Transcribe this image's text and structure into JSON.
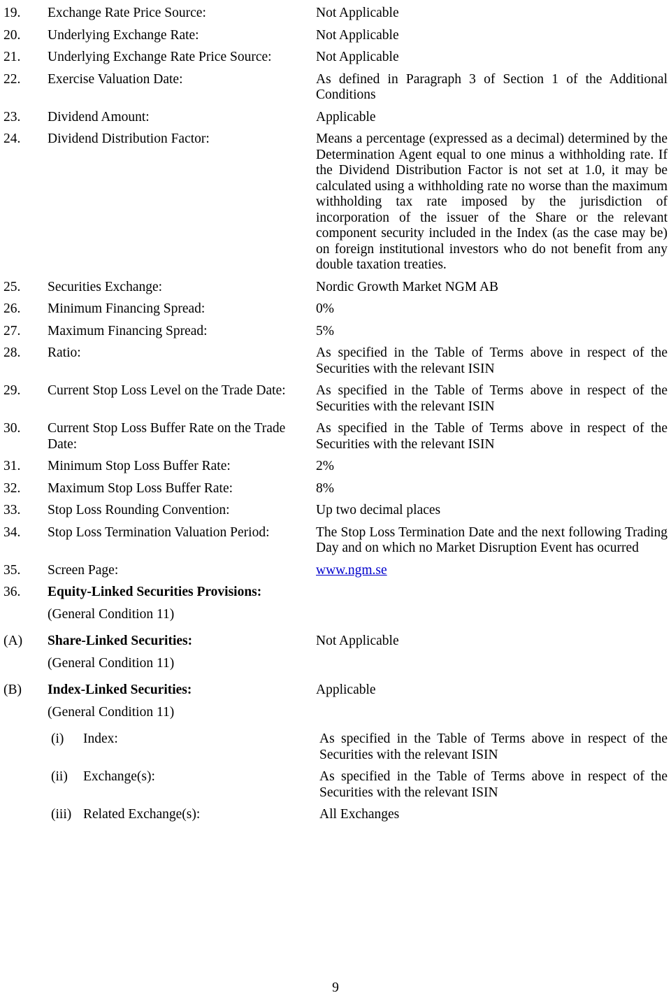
{
  "document": {
    "page_number": "9",
    "link_color": "#0000cc"
  },
  "items": [
    {
      "num": "19.",
      "label": "Exchange Rate Price Source:",
      "value": "Not Applicable"
    },
    {
      "num": "20.",
      "label": "Underlying Exchange Rate:",
      "value": "Not Applicable"
    },
    {
      "num": "21.",
      "label": "Underlying Exchange Rate Price Source:",
      "value": "Not Applicable"
    },
    {
      "num": "22.",
      "label": "Exercise Valuation Date:",
      "value": "As defined in Paragraph 3 of Section 1 of the Additional Conditions"
    },
    {
      "num": "23.",
      "label": "Dividend Amount:",
      "value": "Applicable"
    },
    {
      "num": "24.",
      "label": "Dividend Distribution Factor:",
      "value": "Means a percentage (expressed as a decimal) determined by the Determination Agent equal to one minus a withholding rate. If the Dividend Distribution Factor is not set at 1.0, it may be calculated using a withholding rate no worse than the maximum withholding tax rate imposed by the jurisdiction of incorporation of the issuer of the Share or the relevant component security included in the Index (as the case may be) on foreign institutional investors who do not benefit from any double taxation treaties."
    },
    {
      "num": "25.",
      "label": "Securities Exchange:",
      "value": "Nordic Growth Market NGM AB"
    },
    {
      "num": "26.",
      "label": "Minimum Financing Spread:",
      "value": "0%"
    },
    {
      "num": "27.",
      "label": "Maximum Financing Spread:",
      "value": "5%"
    },
    {
      "num": "28.",
      "label": "Ratio:",
      "value": "As specified in the Table of Terms above in respect of the Securities with the relevant ISIN"
    },
    {
      "num": "29.",
      "label": "Current Stop Loss Level on the Trade Date:",
      "value": "As specified in the Table of Terms above in respect of the Securities with the relevant ISIN"
    },
    {
      "num": "30.",
      "label": "Current Stop Loss Buffer Rate on the Trade Date:",
      "value": "As specified in the Table of Terms above in respect of the Securities with the relevant ISIN"
    },
    {
      "num": "31.",
      "label": "Minimum Stop Loss Buffer Rate:",
      "value": "2%"
    },
    {
      "num": "32.",
      "label": "Maximum Stop Loss Buffer Rate:",
      "value": "8%"
    },
    {
      "num": "33.",
      "label": "Stop Loss Rounding Convention:",
      "value": "Up two decimal places"
    },
    {
      "num": "34.",
      "label": "Stop Loss Termination Valuation Period:",
      "value": "The Stop Loss Termination Date and the next following Trading Day and on which no Market Disruption Event has ocurred"
    },
    {
      "num": "35.",
      "label": "Screen Page:",
      "value": "www.ngm.se"
    }
  ],
  "section36": {
    "num": "36.",
    "heading": "Equity-Linked Securities Provisions:",
    "condition_note": "(General Condition 11)",
    "sub_a": {
      "marker": "(A)",
      "label": "Share-Linked Securities:",
      "value": "Not Applicable",
      "condition_note": "(General Condition 11)"
    },
    "sub_b": {
      "marker": "(B)",
      "label": "Index-Linked Securities:",
      "value": "Applicable",
      "condition_note": "(General Condition 11)",
      "sub_items": [
        {
          "marker": "(i)",
          "label": "Index:",
          "value": "As specified in the Table of Terms above in respect of the Securities with the relevant ISIN"
        },
        {
          "marker": "(ii)",
          "label": "Exchange(s):",
          "value": "As specified in the Table of Terms above in respect of the Securities with the relevant ISIN"
        },
        {
          "marker": "(iii)",
          "label": "Related Exchange(s):",
          "value": "All Exchanges"
        }
      ]
    }
  }
}
